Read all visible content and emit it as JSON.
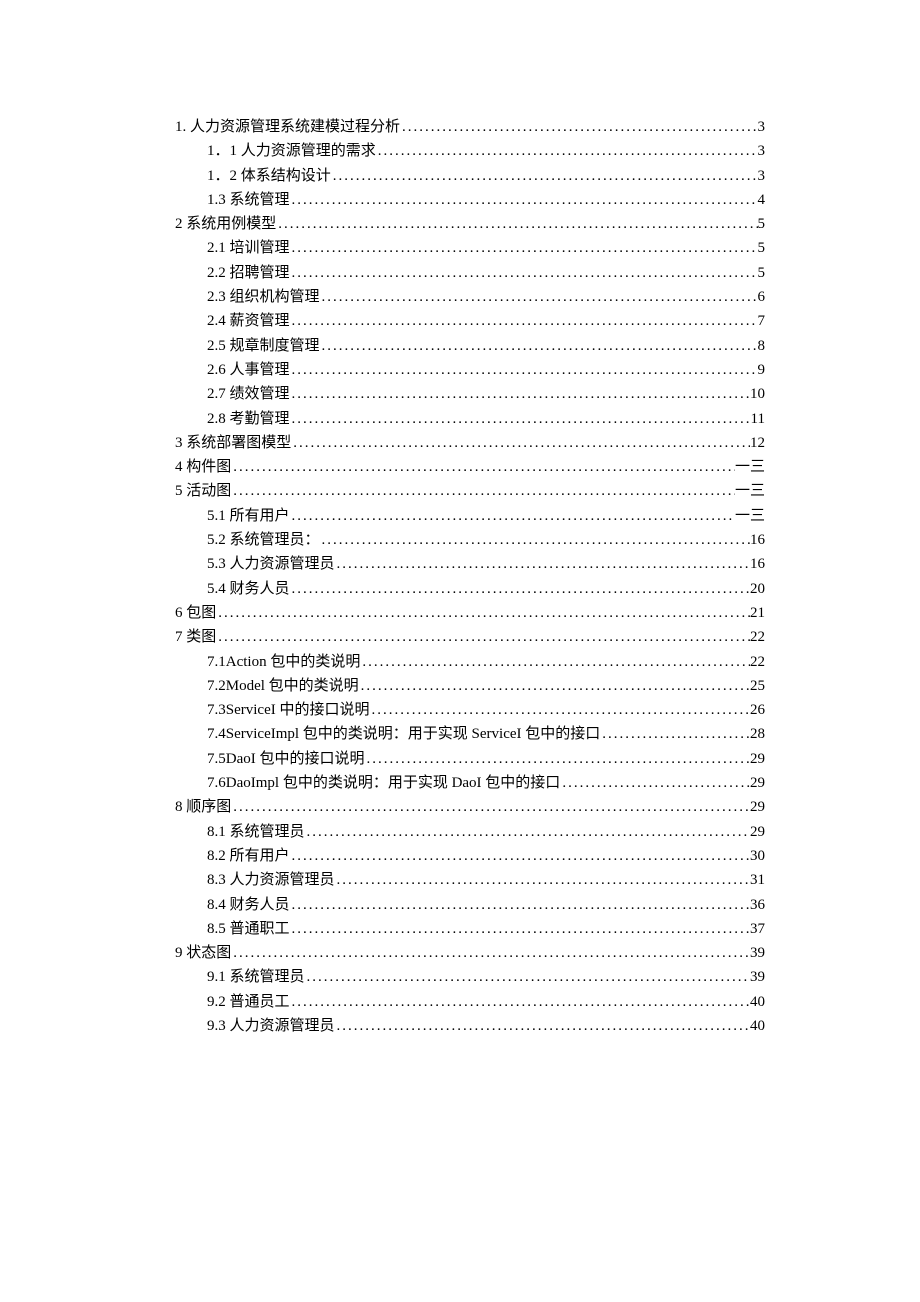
{
  "toc": [
    {
      "level": 1,
      "title": "1.  人力资源管理系统建模过程分析",
      "page": "3"
    },
    {
      "level": 2,
      "title": "1．1 人力资源管理的需求",
      "page": "3"
    },
    {
      "level": 2,
      "title": "1．2 体系结构设计",
      "page": "3"
    },
    {
      "level": 2,
      "title": "1.3 系统管理",
      "page": "4"
    },
    {
      "level": 1,
      "title": "2  系统用例模型",
      "page": "5"
    },
    {
      "level": 2,
      "title": "2.1 培训管理",
      "page": "5"
    },
    {
      "level": 2,
      "title": "2.2 招聘管理",
      "page": "5"
    },
    {
      "level": 2,
      "title": "2.3 组织机构管理",
      "page": "6"
    },
    {
      "level": 2,
      "title": "2.4 薪资管理",
      "page": "7"
    },
    {
      "level": 2,
      "title": "2.5 规章制度管理",
      "page": "8"
    },
    {
      "level": 2,
      "title": "2.6 人事管理",
      "page": "9"
    },
    {
      "level": 2,
      "title": "2.7 绩效管理",
      "page": "10"
    },
    {
      "level": 2,
      "title": "2.8 考勤管理",
      "page": "11"
    },
    {
      "level": 1,
      "title": "3  系统部署图模型",
      "page": "12"
    },
    {
      "level": 1,
      "title": "4  构件图",
      "page": "一三"
    },
    {
      "level": 1,
      "title": "5  活动图",
      "page": "一三"
    },
    {
      "level": 2,
      "title": "5.1 所有用户",
      "page": "一三"
    },
    {
      "level": 2,
      "title": "5.2 系统管理员：",
      "page": "16"
    },
    {
      "level": 2,
      "title": "5.3 人力资源管理员",
      "page": "16"
    },
    {
      "level": 2,
      "title": "5.4 财务人员",
      "page": "20"
    },
    {
      "level": 1,
      "title": "6  包图",
      "page": "21"
    },
    {
      "level": 1,
      "title": "7  类图",
      "page": "22"
    },
    {
      "level": 2,
      "title": "7.1Action 包中的类说明",
      "page": "22"
    },
    {
      "level": 2,
      "title": "7.2Model 包中的类说明 ",
      "page": "25"
    },
    {
      "level": 2,
      "title": "7.3ServiceI 中的接口说明 ",
      "page": "26"
    },
    {
      "level": 2,
      "title": "7.4ServiceImpl 包中的类说明：用于实现 ServiceI 包中的接口",
      "page": "28"
    },
    {
      "level": 2,
      "title": "7.5DaoI 包中的接口说明",
      "page": "29"
    },
    {
      "level": 2,
      "title": "7.6DaoImpl 包中的类说明：用于实现 DaoI 包中的接口 ",
      "page": "29"
    },
    {
      "level": 1,
      "title": "8  顺序图",
      "page": "29"
    },
    {
      "level": 2,
      "title": "8.1 系统管理员",
      "page": "29"
    },
    {
      "level": 2,
      "title": "8.2 所有用户",
      "page": "30"
    },
    {
      "level": 2,
      "title": "8.3 人力资源管理员",
      "page": "31"
    },
    {
      "level": 2,
      "title": "8.4 财务人员",
      "page": "36"
    },
    {
      "level": 2,
      "title": "8.5 普通职工",
      "page": "37"
    },
    {
      "level": 1,
      "title": "9  状态图",
      "page": "39"
    },
    {
      "level": 2,
      "title": "9.1 系统管理员",
      "page": "39"
    },
    {
      "level": 2,
      "title": "9.2 普通员工",
      "page": "40"
    },
    {
      "level": 2,
      "title": "9.3 人力资源管理员",
      "page": "40"
    }
  ]
}
